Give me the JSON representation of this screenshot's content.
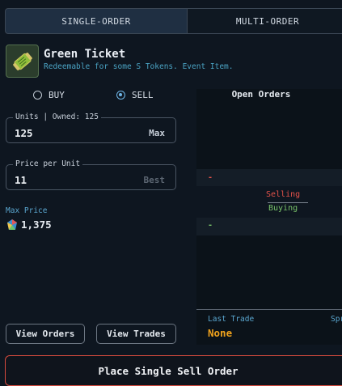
{
  "tabs": {
    "single": "SINGLE-ORDER",
    "multi": "MULTI-ORDER"
  },
  "item": {
    "name": "Green Ticket",
    "description": "Redeemable for some S Tokens. Event Item.",
    "icon": "green-ticket-icon"
  },
  "order_type": {
    "buy": "BUY",
    "sell": "SELL",
    "selected": "SELL"
  },
  "units": {
    "legend": "Units | Owned: 125",
    "value": "125",
    "max_label": "Max"
  },
  "price": {
    "legend": "Price per Unit",
    "value": "11",
    "best_label": "Best"
  },
  "max_price": {
    "label": "Max Price",
    "value": "1,375"
  },
  "buttons": {
    "view_orders": "View Orders",
    "view_trades": "View Trades",
    "place": "Place Single Sell Order"
  },
  "order_book": {
    "title": "Open Orders",
    "selling": "Selling",
    "buying": "Buying",
    "sell_row": "-",
    "buy_row": "-",
    "last_trade_label": "Last Trade",
    "last_trade_value": "None",
    "spread_label": "Spr"
  },
  "colors": {
    "accent": "#6fb5e6",
    "sell": "#e4524a",
    "buy": "#7ac46a",
    "last_trade": "#f0a21c",
    "place_border": "#d74b3e"
  }
}
